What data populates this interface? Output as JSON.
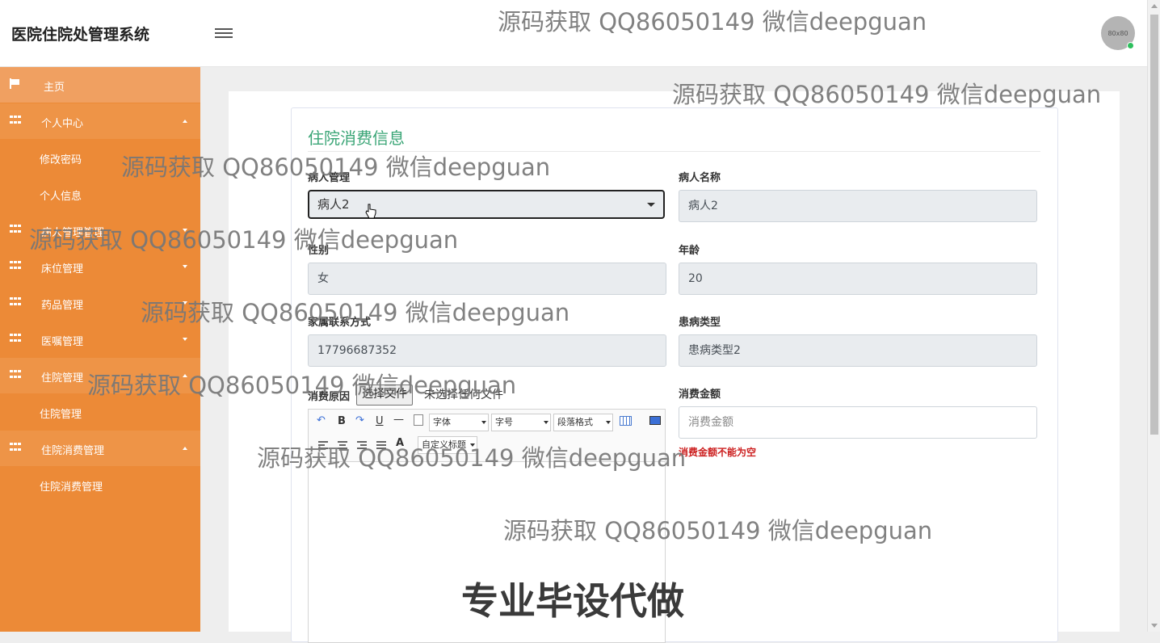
{
  "app": {
    "title": "医院住院处管理系统",
    "avatar_text": "80x80"
  },
  "sidebar": {
    "items": [
      {
        "label": "主页"
      },
      {
        "label": "个人中心"
      },
      {
        "label": "病人管理管理"
      },
      {
        "label": "床位管理"
      },
      {
        "label": "药品管理"
      },
      {
        "label": "医嘱管理"
      },
      {
        "label": "住院管理"
      },
      {
        "label": "住院消费管理"
      }
    ],
    "sub_items": {
      "personal": [
        "修改密码",
        "个人信息"
      ],
      "hospitalization": [
        "住院管理"
      ],
      "consumption": [
        "住院消费管理"
      ]
    }
  },
  "form": {
    "title": "住院消费信息",
    "patient_manage_label": "病人管理",
    "patient_manage_value": "病人2",
    "patient_name_label": "病人名称",
    "patient_name_value": "病人2",
    "gender_label": "性别",
    "gender_value": "女",
    "age_label": "年龄",
    "age_value": "20",
    "family_contact_label": "家属联系方式",
    "family_contact_value": "17796687352",
    "disease_type_label": "患病类型",
    "disease_type_value": "患病类型2",
    "reason_label": "消费原因",
    "file_button": "选择文件",
    "file_status": "未选择任何文件",
    "amount_label": "消费金额",
    "amount_placeholder": "消费金额",
    "amount_error": "消费金额不能为空"
  },
  "editor": {
    "font_family": "字体",
    "font_size": "字号",
    "paragraph": "段落格式",
    "custom_title": "自定义标题",
    "bold": "B",
    "italic": "I",
    "underline": "U",
    "font_color": "A"
  },
  "watermarks": {
    "text": "源码获取 QQ86050149 微信deepguan",
    "ad": "专业毕设代做"
  }
}
